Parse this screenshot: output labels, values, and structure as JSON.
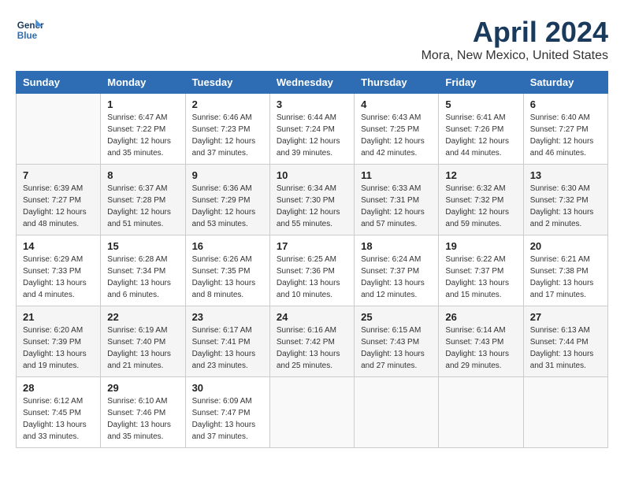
{
  "header": {
    "logo_line1": "General",
    "logo_line2": "Blue",
    "title": "April 2024",
    "subtitle": "Mora, New Mexico, United States"
  },
  "calendar": {
    "days_of_week": [
      "Sunday",
      "Monday",
      "Tuesday",
      "Wednesday",
      "Thursday",
      "Friday",
      "Saturday"
    ],
    "weeks": [
      [
        {
          "day": "",
          "empty": true
        },
        {
          "day": "1",
          "sunrise": "6:47 AM",
          "sunset": "7:22 PM",
          "daylight": "12 hours and 35 minutes."
        },
        {
          "day": "2",
          "sunrise": "6:46 AM",
          "sunset": "7:23 PM",
          "daylight": "12 hours and 37 minutes."
        },
        {
          "day": "3",
          "sunrise": "6:44 AM",
          "sunset": "7:24 PM",
          "daylight": "12 hours and 39 minutes."
        },
        {
          "day": "4",
          "sunrise": "6:43 AM",
          "sunset": "7:25 PM",
          "daylight": "12 hours and 42 minutes."
        },
        {
          "day": "5",
          "sunrise": "6:41 AM",
          "sunset": "7:26 PM",
          "daylight": "12 hours and 44 minutes."
        },
        {
          "day": "6",
          "sunrise": "6:40 AM",
          "sunset": "7:27 PM",
          "daylight": "12 hours and 46 minutes."
        }
      ],
      [
        {
          "day": "7",
          "sunrise": "6:39 AM",
          "sunset": "7:27 PM",
          "daylight": "12 hours and 48 minutes."
        },
        {
          "day": "8",
          "sunrise": "6:37 AM",
          "sunset": "7:28 PM",
          "daylight": "12 hours and 51 minutes."
        },
        {
          "day": "9",
          "sunrise": "6:36 AM",
          "sunset": "7:29 PM",
          "daylight": "12 hours and 53 minutes."
        },
        {
          "day": "10",
          "sunrise": "6:34 AM",
          "sunset": "7:30 PM",
          "daylight": "12 hours and 55 minutes."
        },
        {
          "day": "11",
          "sunrise": "6:33 AM",
          "sunset": "7:31 PM",
          "daylight": "12 hours and 57 minutes."
        },
        {
          "day": "12",
          "sunrise": "6:32 AM",
          "sunset": "7:32 PM",
          "daylight": "12 hours and 59 minutes."
        },
        {
          "day": "13",
          "sunrise": "6:30 AM",
          "sunset": "7:32 PM",
          "daylight": "13 hours and 2 minutes."
        }
      ],
      [
        {
          "day": "14",
          "sunrise": "6:29 AM",
          "sunset": "7:33 PM",
          "daylight": "13 hours and 4 minutes."
        },
        {
          "day": "15",
          "sunrise": "6:28 AM",
          "sunset": "7:34 PM",
          "daylight": "13 hours and 6 minutes."
        },
        {
          "day": "16",
          "sunrise": "6:26 AM",
          "sunset": "7:35 PM",
          "daylight": "13 hours and 8 minutes."
        },
        {
          "day": "17",
          "sunrise": "6:25 AM",
          "sunset": "7:36 PM",
          "daylight": "13 hours and 10 minutes."
        },
        {
          "day": "18",
          "sunrise": "6:24 AM",
          "sunset": "7:37 PM",
          "daylight": "13 hours and 12 minutes."
        },
        {
          "day": "19",
          "sunrise": "6:22 AM",
          "sunset": "7:37 PM",
          "daylight": "13 hours and 15 minutes."
        },
        {
          "day": "20",
          "sunrise": "6:21 AM",
          "sunset": "7:38 PM",
          "daylight": "13 hours and 17 minutes."
        }
      ],
      [
        {
          "day": "21",
          "sunrise": "6:20 AM",
          "sunset": "7:39 PM",
          "daylight": "13 hours and 19 minutes."
        },
        {
          "day": "22",
          "sunrise": "6:19 AM",
          "sunset": "7:40 PM",
          "daylight": "13 hours and 21 minutes."
        },
        {
          "day": "23",
          "sunrise": "6:17 AM",
          "sunset": "7:41 PM",
          "daylight": "13 hours and 23 minutes."
        },
        {
          "day": "24",
          "sunrise": "6:16 AM",
          "sunset": "7:42 PM",
          "daylight": "13 hours and 25 minutes."
        },
        {
          "day": "25",
          "sunrise": "6:15 AM",
          "sunset": "7:43 PM",
          "daylight": "13 hours and 27 minutes."
        },
        {
          "day": "26",
          "sunrise": "6:14 AM",
          "sunset": "7:43 PM",
          "daylight": "13 hours and 29 minutes."
        },
        {
          "day": "27",
          "sunrise": "6:13 AM",
          "sunset": "7:44 PM",
          "daylight": "13 hours and 31 minutes."
        }
      ],
      [
        {
          "day": "28",
          "sunrise": "6:12 AM",
          "sunset": "7:45 PM",
          "daylight": "13 hours and 33 minutes."
        },
        {
          "day": "29",
          "sunrise": "6:10 AM",
          "sunset": "7:46 PM",
          "daylight": "13 hours and 35 minutes."
        },
        {
          "day": "30",
          "sunrise": "6:09 AM",
          "sunset": "7:47 PM",
          "daylight": "13 hours and 37 minutes."
        },
        {
          "day": "",
          "empty": true
        },
        {
          "day": "",
          "empty": true
        },
        {
          "day": "",
          "empty": true
        },
        {
          "day": "",
          "empty": true
        }
      ]
    ]
  }
}
